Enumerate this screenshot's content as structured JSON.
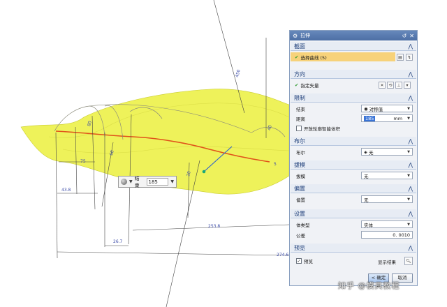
{
  "viewport": {
    "dimensions": [
      "43.8",
      "26.7",
      "253.8",
      "274.6",
      "75",
      "80",
      "60",
      "40",
      "20",
      "450",
      "5"
    ],
    "inline_input": {
      "label": "结束",
      "value": "185"
    }
  },
  "dialog": {
    "title": "拉伸",
    "sections": {
      "section": {
        "heading": "截面",
        "select_curve": "选择曲线 (5)"
      },
      "direction": {
        "heading": "方向",
        "specify_vector": "指定矢量"
      },
      "limits": {
        "heading": "限制",
        "end_label": "结束",
        "end_value": "对称值",
        "distance_label": "距离",
        "distance_value": "185",
        "distance_unit": "mm",
        "open_profile": "开放轮廓智能体积"
      },
      "boolean": {
        "heading": "布尔",
        "label": "布尔",
        "value": "无"
      },
      "draft": {
        "heading": "拔模",
        "label": "拔模",
        "value": "无"
      },
      "offset": {
        "heading": "偏置",
        "label": "偏置",
        "value": "无"
      },
      "settings": {
        "heading": "设置",
        "body_type_label": "体类型",
        "body_type_value": "实体",
        "tolerance_label": "公差",
        "tolerance_value": "0. 0010"
      },
      "preview": {
        "heading": "预览",
        "preview_label": "预览",
        "show_result": "显示结果"
      }
    },
    "buttons": {
      "ok": "< 确定 >",
      "cancel": "取消"
    }
  },
  "watermark": "知乎 @模具教程",
  "colors": {
    "surface": "#eef25a",
    "profile": "#e0521a",
    "title_bar": "#4d6fa5",
    "highlight_row": "#f7d27a",
    "dimension": "#3b4ba8"
  }
}
